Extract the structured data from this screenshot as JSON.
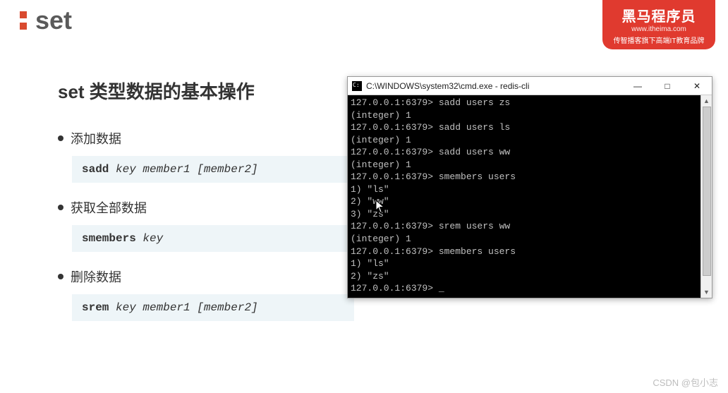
{
  "header": {
    "title": "set"
  },
  "brand": {
    "title_cn": "黑马程序员",
    "url": "www.itheima.com",
    "tagline": "传智播客旗下高端IT教育品牌"
  },
  "slide": {
    "section_title": "set 类型数据的基本操作",
    "ops": [
      {
        "label": "添加数据",
        "cmd": "sadd",
        "args": "key member1 [member2]"
      },
      {
        "label": "获取全部数据",
        "cmd": "smembers",
        "args": "key"
      },
      {
        "label": "删除数据",
        "cmd": "srem",
        "args": "key member1 [member2]"
      }
    ]
  },
  "terminal": {
    "titlebar_text": "C:\\WINDOWS\\system32\\cmd.exe - redis-cli",
    "minimize": "—",
    "maximize": "□",
    "close": "✕",
    "scroll_up": "▲",
    "scroll_down": "▼",
    "lines": [
      "127.0.0.1:6379> sadd users zs",
      "(integer) 1",
      "127.0.0.1:6379> sadd users ls",
      "(integer) 1",
      "127.0.0.1:6379> sadd users ww",
      "(integer) 1",
      "127.0.0.1:6379> smembers users",
      "1) \"ls\"",
      "2) \"ww\"",
      "3) \"zs\"",
      "127.0.0.1:6379> srem users ww",
      "(integer) 1",
      "127.0.0.1:6379> smembers users",
      "1) \"ls\"",
      "2) \"zs\"",
      "127.0.0.1:6379> _"
    ]
  },
  "watermark": "CSDN @包小志"
}
